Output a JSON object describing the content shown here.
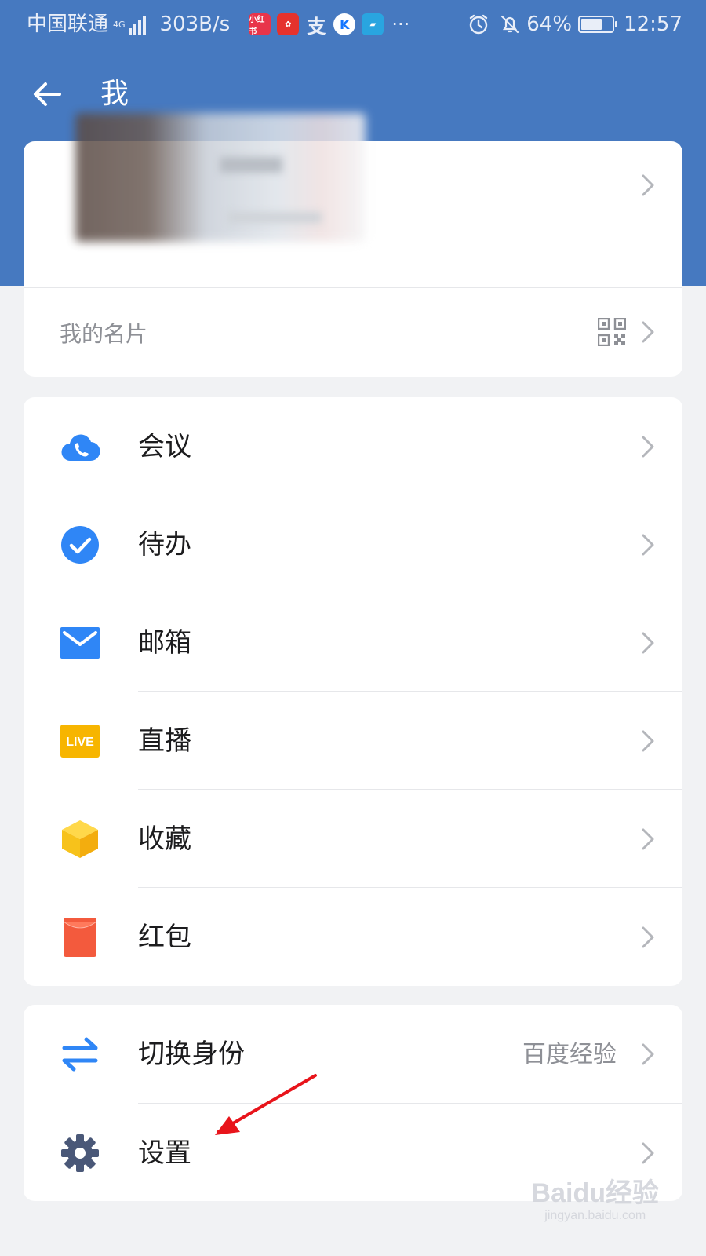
{
  "status_bar": {
    "carrier": "中国联通",
    "network": "4G",
    "speed": "303B/s",
    "app_icons": [
      {
        "name": "xiaohongshu-icon",
        "label": "小红书",
        "color": "#e8344a"
      },
      {
        "name": "food-app-icon",
        "label": "",
        "color": "#e5322d"
      },
      {
        "name": "alipay-icon",
        "label": "支",
        "color": "#4679c0"
      },
      {
        "name": "k-app-icon",
        "label": "K",
        "color": "#1677ff"
      },
      {
        "name": "truck-app-icon",
        "label": "",
        "color": "#29a5e0"
      }
    ],
    "more": "···",
    "battery": "64%",
    "time": "12:57"
  },
  "header": {
    "title": "我"
  },
  "profile": {
    "card_label": "我的名片"
  },
  "menu": {
    "items": [
      {
        "label": "会议",
        "icon": "meeting-cloud-phone-icon",
        "color": "#2f86f6"
      },
      {
        "label": "待办",
        "icon": "todo-check-icon",
        "color": "#2f86f6"
      },
      {
        "label": "邮箱",
        "icon": "mail-envelope-icon",
        "color": "#2f86f6"
      },
      {
        "label": "直播",
        "icon": "live-badge-icon",
        "color": "#f7b500",
        "badge_text": "LIVE"
      },
      {
        "label": "收藏",
        "icon": "favorites-box-icon",
        "color": "#f7c21b"
      },
      {
        "label": "红包",
        "icon": "red-envelope-icon",
        "color": "#f35a3d"
      }
    ]
  },
  "account": {
    "switch_label": "切换身份",
    "switch_value": "百度经验",
    "settings_label": "设置"
  },
  "watermark": {
    "main": "Baidu经验",
    "sub": "jingyan.baidu.com"
  }
}
